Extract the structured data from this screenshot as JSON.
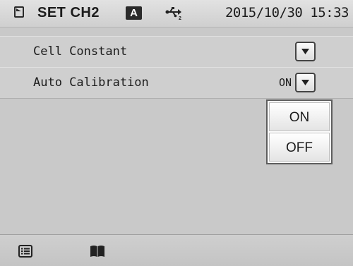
{
  "status_bar": {
    "title": "SET CH2",
    "mode_badge": "A",
    "usb_icon": "usb-icon",
    "datetime": "2015/10/30 15:33"
  },
  "settings": [
    {
      "label": "Cell Constant",
      "value": ""
    },
    {
      "label": "Auto Calibration",
      "value": "ON"
    }
  ],
  "dropdown_options": [
    "ON",
    "OFF"
  ],
  "bottom_bar": {
    "icons": [
      "list-icon",
      "book-icon"
    ]
  }
}
